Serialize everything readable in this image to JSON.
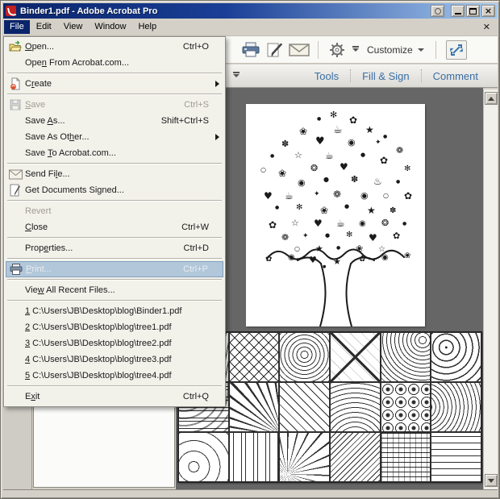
{
  "window": {
    "title": "Binder1.pdf - Adobe Acrobat Pro",
    "controls": {
      "extra": "options",
      "minimize": "minimize",
      "maximize": "maximize",
      "close": "close"
    }
  },
  "menubar": {
    "items": [
      {
        "label": "File",
        "active": true
      },
      {
        "label": "Edit",
        "active": false
      },
      {
        "label": "View",
        "active": false
      },
      {
        "label": "Window",
        "active": false
      },
      {
        "label": "Help",
        "active": false
      }
    ],
    "close_document_glyph": "✕"
  },
  "toolbar": {
    "icons": [
      "print-icon",
      "sign-document-icon",
      "email-icon",
      "gear-icon",
      "expand-icon"
    ],
    "customize_label": "Customize",
    "nav_tabs": [
      "Tools",
      "Fill & Sign",
      "Comment"
    ]
  },
  "file_menu": {
    "items": [
      {
        "label": "Open...",
        "shortcut": "Ctrl+O",
        "icon": "folder-open",
        "mnemonic": 0
      },
      {
        "label": "Open From Acrobat.com...",
        "mnemonic": 3
      },
      {
        "separator": true
      },
      {
        "label": "Create",
        "icon": "create-page",
        "mnemonic": 1,
        "submenu": true
      },
      {
        "separator": true
      },
      {
        "label": "Save",
        "shortcut": "Ctrl+S",
        "icon": "floppy",
        "mnemonic": 0,
        "disabled": true
      },
      {
        "label": "Save As...",
        "shortcut": "Shift+Ctrl+S",
        "mnemonic": 5
      },
      {
        "label": "Save As Other...",
        "mnemonic": 10,
        "submenu": true
      },
      {
        "label": "Save To Acrobat.com...",
        "mnemonic": 5
      },
      {
        "separator": true
      },
      {
        "label": "Send File...",
        "icon": "envelope",
        "mnemonic": 7
      },
      {
        "label": "Get Documents Signed...",
        "icon": "sign-doc"
      },
      {
        "separator": true
      },
      {
        "label": "Revert",
        "disabled": true
      },
      {
        "label": "Close",
        "shortcut": "Ctrl+W",
        "mnemonic": 0
      },
      {
        "separator": true
      },
      {
        "label": "Properties...",
        "shortcut": "Ctrl+D",
        "mnemonic": 4
      },
      {
        "separator": true
      },
      {
        "label": "Print...",
        "shortcut": "Ctrl+P",
        "icon": "printer",
        "mnemonic": 0,
        "highlighted": true
      },
      {
        "separator": true
      },
      {
        "label": "View All Recent Files...",
        "mnemonic": 3
      },
      {
        "separator": true
      },
      {
        "label": "1 C:\\Users\\JB\\Desktop\\blog\\Binder1.pdf",
        "mnemonic": 0
      },
      {
        "label": "2 C:\\Users\\JB\\Desktop\\blog\\tree1.pdf",
        "mnemonic": 0
      },
      {
        "label": "3 C:\\Users\\JB\\Desktop\\blog\\tree2.pdf",
        "mnemonic": 0
      },
      {
        "label": "4 C:\\Users\\JB\\Desktop\\blog\\tree3.pdf",
        "mnemonic": 0
      },
      {
        "label": "5 C:\\Users\\JB\\Desktop\\blog\\tree4.pdf",
        "mnemonic": 0
      },
      {
        "separator": true
      },
      {
        "label": "Exit",
        "shortcut": "Ctrl+Q",
        "mnemonic": 1
      }
    ]
  },
  "document": {
    "pages": [
      {
        "name": "tree-coloring-page",
        "description": "coloring page of a tree whose canopy is made of food and flower doodles"
      },
      {
        "name": "pattern-coloring-page",
        "description": "coloring page grid of zentangle pattern squares"
      }
    ]
  },
  "tree_doodles": [
    [
      "✻",
      104,
      8,
      11
    ],
    [
      "●",
      88,
      16,
      6
    ],
    [
      "✿",
      128,
      14,
      12
    ],
    [
      "❀",
      66,
      28,
      12
    ],
    [
      "★",
      148,
      26,
      12
    ],
    [
      "☕",
      108,
      26,
      13
    ],
    [
      "●",
      170,
      38,
      6
    ],
    [
      "✽",
      44,
      44,
      11
    ],
    [
      "♥",
      86,
      40,
      13
    ],
    [
      "◉",
      126,
      42,
      11
    ],
    [
      "✦",
      160,
      44,
      9
    ],
    [
      "❁",
      186,
      52,
      11
    ],
    [
      "●",
      30,
      62,
      6
    ],
    [
      "☆",
      60,
      58,
      11
    ],
    [
      "☕",
      98,
      58,
      12
    ],
    [
      "●",
      142,
      60,
      7
    ],
    [
      "✿",
      166,
      64,
      12
    ],
    [
      "❂",
      80,
      74,
      11
    ],
    [
      "♥",
      116,
      72,
      12
    ],
    [
      "✻",
      196,
      76,
      10
    ],
    [
      "○",
      18,
      78,
      8
    ],
    [
      "❀",
      40,
      80,
      12
    ],
    [
      "◉",
      64,
      92,
      11
    ],
    [
      "●",
      96,
      90,
      8
    ],
    [
      "✽",
      130,
      88,
      11
    ],
    [
      "♨",
      158,
      90,
      12
    ],
    [
      "●",
      186,
      94,
      6
    ],
    [
      "♥",
      22,
      108,
      12
    ],
    [
      "☕",
      48,
      108,
      12
    ],
    [
      "✦",
      84,
      108,
      9
    ],
    [
      "❁",
      108,
      106,
      12
    ],
    [
      "◉",
      142,
      108,
      11
    ],
    [
      "✿",
      196,
      108,
      12
    ],
    [
      "○",
      170,
      110,
      8
    ],
    [
      "●",
      36,
      126,
      6
    ],
    [
      "✻",
      62,
      124,
      10
    ],
    [
      "❀",
      92,
      126,
      12
    ],
    [
      "●",
      122,
      124,
      7
    ],
    [
      "★",
      150,
      126,
      12
    ],
    [
      "✽",
      178,
      128,
      10
    ],
    [
      "✿",
      28,
      144,
      12
    ],
    [
      "☆",
      56,
      142,
      11
    ],
    [
      "♥",
      84,
      142,
      12
    ],
    [
      "☕",
      112,
      142,
      12
    ],
    [
      "◉",
      140,
      144,
      10
    ],
    [
      "❂",
      168,
      142,
      11
    ],
    [
      "●",
      194,
      146,
      6
    ],
    [
      "❁",
      44,
      160,
      11
    ],
    [
      "✦",
      70,
      160,
      9
    ],
    [
      "●",
      98,
      160,
      7
    ],
    [
      "✻",
      124,
      158,
      10
    ],
    [
      "♥",
      152,
      160,
      12
    ],
    [
      "✿",
      182,
      158,
      11
    ],
    [
      "○",
      60,
      176,
      8
    ],
    [
      "★",
      86,
      174,
      11
    ],
    [
      "●",
      112,
      176,
      6
    ],
    [
      "❀",
      136,
      174,
      11
    ],
    [
      "☆",
      164,
      176,
      10
    ],
    [
      "✿",
      24,
      188,
      10
    ],
    [
      "◉",
      52,
      186,
      10
    ],
    [
      "♥",
      78,
      188,
      11
    ],
    [
      "★",
      108,
      190,
      11
    ],
    [
      "●",
      95,
      200,
      5
    ],
    [
      "✿",
      140,
      188,
      10
    ],
    [
      "◉",
      168,
      186,
      10
    ],
    [
      "❀",
      196,
      184,
      10
    ]
  ],
  "patterns": [
    "waves",
    "zigzag",
    "rings",
    "diamond",
    "paisley",
    "dots",
    "beads",
    "rays",
    "lattice",
    "arcs",
    "floral",
    "swirls",
    "knots",
    "pillars",
    "fan",
    "chevron",
    "weave",
    "maze"
  ],
  "colors": {
    "titlebar_start": "#0a246a",
    "titlebar_end": "#a6caf0",
    "chrome": "#d4d0c8",
    "document_background": "#666666",
    "accent_blue": "#3b6fa5",
    "menu_highlight": "#b2c7da"
  }
}
